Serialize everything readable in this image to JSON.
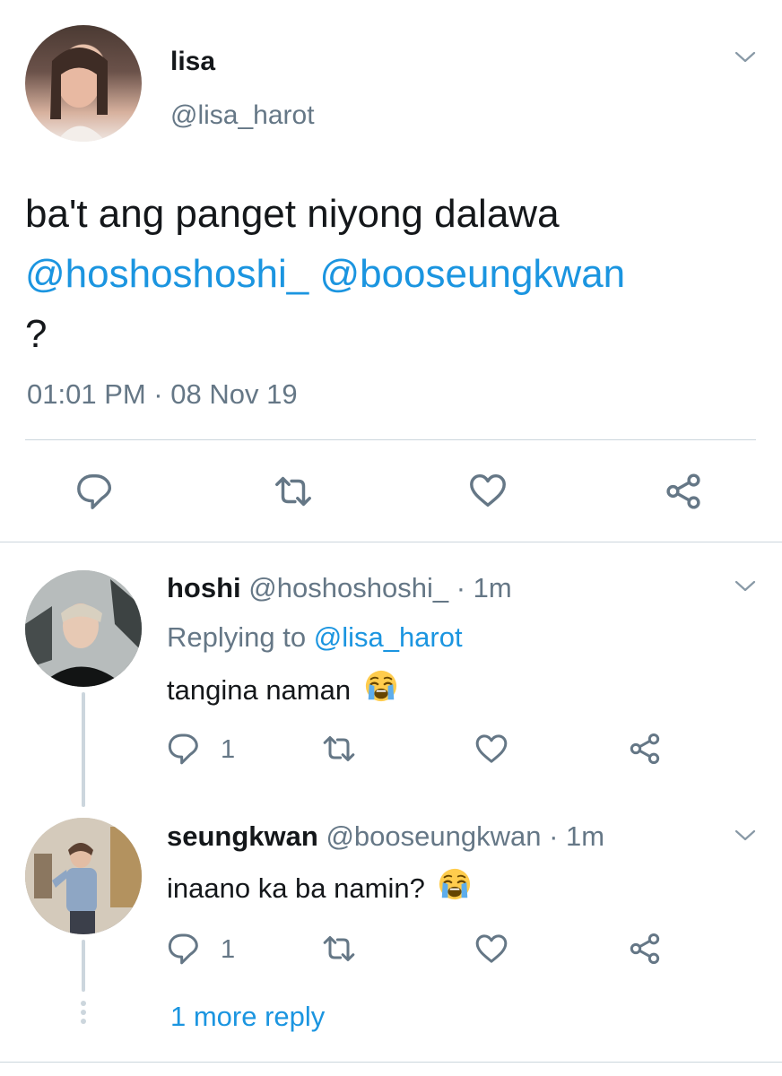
{
  "main_tweet": {
    "display_name": "lisa",
    "handle": "@lisa_harot",
    "text": "ba't ang panget niyong dalawa",
    "mention_1": "@hoshoshoshi_",
    "mention_2": "@booseungkwan",
    "text_end": "?",
    "timestamp": "01:01 PM · 08 Nov 19",
    "actions": [
      "reply-icon",
      "retweet-icon",
      "like-icon",
      "share-icon"
    ]
  },
  "replies": [
    {
      "display_name": "hoshi",
      "handle": "@hoshoshoshi_",
      "time": "· 1m",
      "replying_prefix": "Replying to",
      "replying_to": "@lisa_harot",
      "text": "tangina naman",
      "emoji": "loudly-crying-face",
      "reply_count": "1"
    },
    {
      "display_name": "seungkwan",
      "handle": "@booseungkwan",
      "time": "· 1m",
      "text": "inaano ka ba namin?",
      "emoji": "loudly-crying-face",
      "reply_count": "1"
    }
  ],
  "more_replies": "1 more reply",
  "colors": {
    "link": "#1b95e0",
    "secondary": "#657786",
    "icon": "#657786",
    "divider": "#ccd6dd"
  }
}
